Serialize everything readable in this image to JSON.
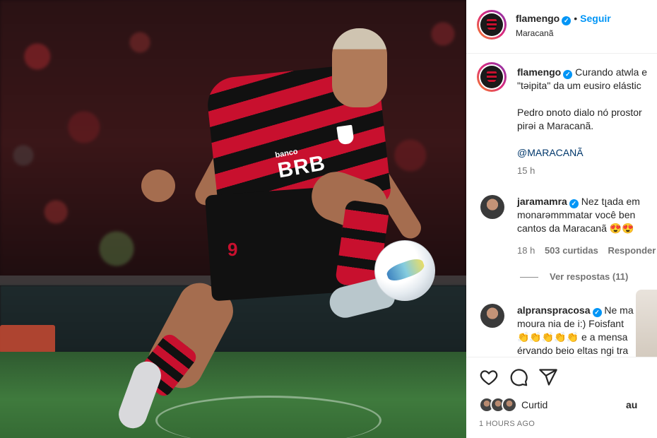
{
  "post": {
    "account": "flamengo",
    "follow_label": "Seguir",
    "location": "Maracanã",
    "caption_line1": "Curando atwla e",
    "caption_line2": "\"təipita\" da um eusiro elástic",
    "caption_line3": "Pedro ɒnoto dialo nó prostor",
    "caption_line4": "pirəi a Maracanã.",
    "caption_tag": "@MARACANÃ",
    "caption_time": "15 h",
    "jersey_number": "9",
    "jersey_sponsor": "BRB",
    "jersey_sponsor_small": "banco"
  },
  "comments": [
    {
      "user": "jaramamra",
      "line1": "Nez tլada em",
      "line2": "monarəmmmatar você ben",
      "line3": "cantos da Maracanã 😍😍",
      "time": "18 h",
      "likes": "503 curtidas",
      "reply_label": "Responder",
      "view_replies": "Ver respostas (11)"
    },
    {
      "user": "alpranspracosa",
      "line1": "Ne ma",
      "line2": "moura nia de i:) Foisfant",
      "line3": "👏👏👏👏👏 e a mensa",
      "line4": "érvando beio eltas ngi tra"
    }
  ],
  "actions": {
    "liked_by": "Curtid",
    "liked_by_suffix": "au",
    "timestamp": "1 HOURS AGO"
  },
  "colors": {
    "accent": "#0095f6",
    "flamengo_red": "#c8102e",
    "text": "#262626",
    "muted": "#737373"
  },
  "icons": [
    "heart-icon",
    "comment-icon",
    "share-icon",
    "verified-badge-icon"
  ]
}
